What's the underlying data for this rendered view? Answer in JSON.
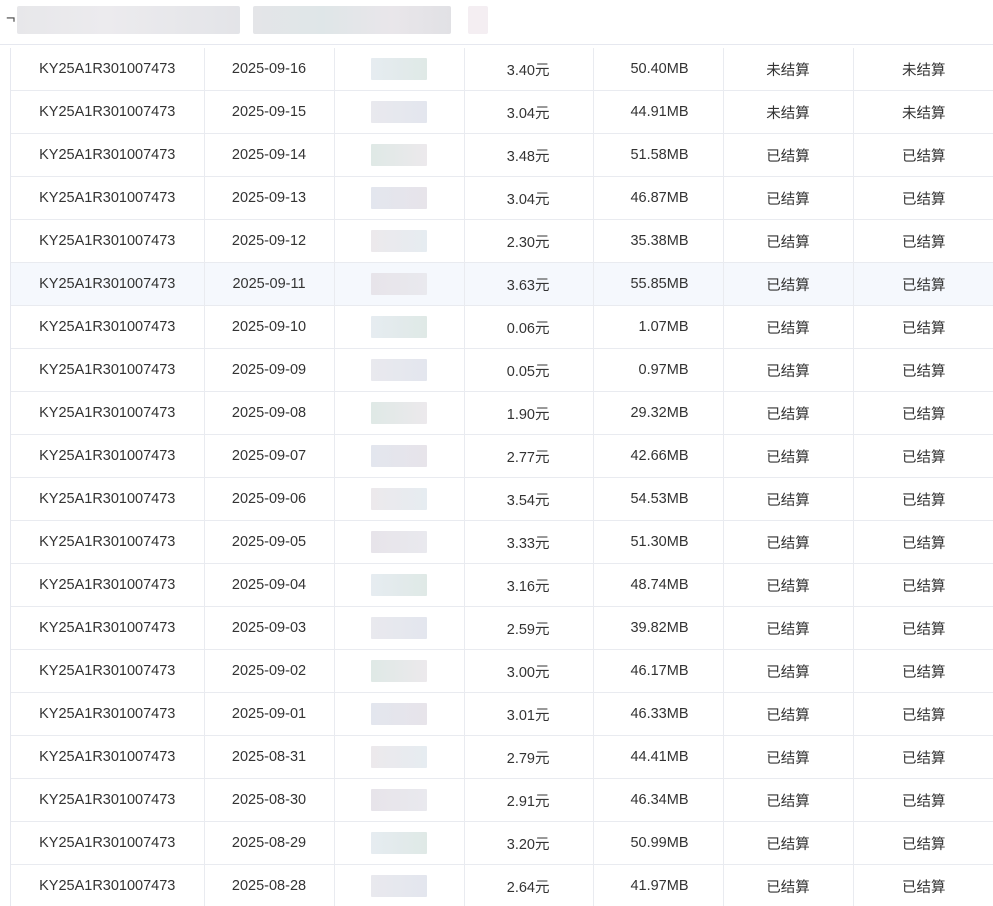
{
  "header": {
    "title_glyph": "¬"
  },
  "table": {
    "rows": [
      {
        "id": "KY25A1R301007473",
        "date": "2025-09-16",
        "amount": "3.40元",
        "traffic": "50.40MB",
        "status_a": "未结算",
        "status_b": "未结算"
      },
      {
        "id": "KY25A1R301007473",
        "date": "2025-09-15",
        "amount": "3.04元",
        "traffic": "44.91MB",
        "status_a": "未结算",
        "status_b": "未结算"
      },
      {
        "id": "KY25A1R301007473",
        "date": "2025-09-14",
        "amount": "3.48元",
        "traffic": "51.58MB",
        "status_a": "已结算",
        "status_b": "已结算"
      },
      {
        "id": "KY25A1R301007473",
        "date": "2025-09-13",
        "amount": "3.04元",
        "traffic": "46.87MB",
        "status_a": "已结算",
        "status_b": "已结算"
      },
      {
        "id": "KY25A1R301007473",
        "date": "2025-09-12",
        "amount": "2.30元",
        "traffic": "35.38MB",
        "status_a": "已结算",
        "status_b": "已结算"
      },
      {
        "id": "KY25A1R301007473",
        "date": "2025-09-11",
        "amount": "3.63元",
        "traffic": "55.85MB",
        "status_a": "已结算",
        "status_b": "已结算"
      },
      {
        "id": "KY25A1R301007473",
        "date": "2025-09-10",
        "amount": "0.06元",
        "traffic": "1.07MB",
        "status_a": "已结算",
        "status_b": "已结算"
      },
      {
        "id": "KY25A1R301007473",
        "date": "2025-09-09",
        "amount": "0.05元",
        "traffic": "0.97MB",
        "status_a": "已结算",
        "status_b": "已结算"
      },
      {
        "id": "KY25A1R301007473",
        "date": "2025-09-08",
        "amount": "1.90元",
        "traffic": "29.32MB",
        "status_a": "已结算",
        "status_b": "已结算"
      },
      {
        "id": "KY25A1R301007473",
        "date": "2025-09-07",
        "amount": "2.77元",
        "traffic": "42.66MB",
        "status_a": "已结算",
        "status_b": "已结算"
      },
      {
        "id": "KY25A1R301007473",
        "date": "2025-09-06",
        "amount": "3.54元",
        "traffic": "54.53MB",
        "status_a": "已结算",
        "status_b": "已结算"
      },
      {
        "id": "KY25A1R301007473",
        "date": "2025-09-05",
        "amount": "3.33元",
        "traffic": "51.30MB",
        "status_a": "已结算",
        "status_b": "已结算"
      },
      {
        "id": "KY25A1R301007473",
        "date": "2025-09-04",
        "amount": "3.16元",
        "traffic": "48.74MB",
        "status_a": "已结算",
        "status_b": "已结算"
      },
      {
        "id": "KY25A1R301007473",
        "date": "2025-09-03",
        "amount": "2.59元",
        "traffic": "39.82MB",
        "status_a": "已结算",
        "status_b": "已结算"
      },
      {
        "id": "KY25A1R301007473",
        "date": "2025-09-02",
        "amount": "3.00元",
        "traffic": "46.17MB",
        "status_a": "已结算",
        "status_b": "已结算"
      },
      {
        "id": "KY25A1R301007473",
        "date": "2025-09-01",
        "amount": "3.01元",
        "traffic": "46.33MB",
        "status_a": "已结算",
        "status_b": "已结算"
      },
      {
        "id": "KY25A1R301007473",
        "date": "2025-08-31",
        "amount": "2.79元",
        "traffic": "44.41MB",
        "status_a": "已结算",
        "status_b": "已结算"
      },
      {
        "id": "KY25A1R301007473",
        "date": "2025-08-30",
        "amount": "2.91元",
        "traffic": "46.34MB",
        "status_a": "已结算",
        "status_b": "已结算"
      },
      {
        "id": "KY25A1R301007473",
        "date": "2025-08-29",
        "amount": "3.20元",
        "traffic": "50.99MB",
        "status_a": "已结算",
        "status_b": "已结算"
      },
      {
        "id": "KY25A1R301007473",
        "date": "2025-08-28",
        "amount": "2.64元",
        "traffic": "41.97MB",
        "status_a": "已结算",
        "status_b": "已结算"
      }
    ],
    "highlighted_row": 5
  },
  "colors": {
    "redaction": [
      "#e6ecf1",
      "#e9e9ee",
      "#dfe9e6",
      "#e3e6ee",
      "#ece9ec",
      "#e7e4ea"
    ],
    "row_highlight": "#f5f8fd",
    "grid_line": "#e9ebf0",
    "text": "#333333"
  }
}
